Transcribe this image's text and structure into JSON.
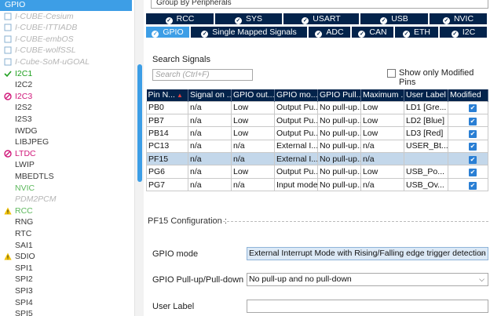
{
  "tree": [
    {
      "label": "GPIO",
      "style": "selected",
      "icon": ""
    },
    {
      "label": "I-CUBE-Cesium",
      "style": "grey",
      "icon": "component-icon"
    },
    {
      "label": "I-CUBE-ITTIADB",
      "style": "grey",
      "icon": "component-icon"
    },
    {
      "label": "I-CUBE-embOS",
      "style": "grey",
      "icon": "component-icon"
    },
    {
      "label": "I-CUBE-wolfSSL",
      "style": "grey",
      "icon": "component-icon"
    },
    {
      "label": "I-Cube-SoM-uGOAL",
      "style": "grey",
      "icon": "component-icon"
    },
    {
      "label": "I2C1",
      "style": "green",
      "icon": "check-icon"
    },
    {
      "label": "I2C2",
      "style": "dark",
      "icon": ""
    },
    {
      "label": "I2C3",
      "style": "magenta",
      "icon": "blocked-icon"
    },
    {
      "label": "I2S2",
      "style": "dark",
      "icon": ""
    },
    {
      "label": "I2S3",
      "style": "dark",
      "icon": ""
    },
    {
      "label": "IWDG",
      "style": "dark",
      "icon": ""
    },
    {
      "label": "LIBJPEG",
      "style": "dark",
      "icon": ""
    },
    {
      "label": "LTDC",
      "style": "magenta",
      "icon": "blocked-icon"
    },
    {
      "label": "LWIP",
      "style": "dark",
      "icon": ""
    },
    {
      "label": "MBEDTLS",
      "style": "dark",
      "icon": ""
    },
    {
      "label": "NVIC",
      "style": "lightgreen",
      "icon": ""
    },
    {
      "label": "PDM2PCM",
      "style": "grey",
      "icon": ""
    },
    {
      "label": "RCC",
      "style": "lightgreen",
      "icon": "warning-icon"
    },
    {
      "label": "RNG",
      "style": "dark",
      "icon": ""
    },
    {
      "label": "RTC",
      "style": "dark",
      "icon": ""
    },
    {
      "label": "SAI1",
      "style": "dark",
      "icon": ""
    },
    {
      "label": "SDIO",
      "style": "dark",
      "icon": "warning-icon"
    },
    {
      "label": "SPI1",
      "style": "dark",
      "icon": ""
    },
    {
      "label": "SPI2",
      "style": "dark",
      "icon": ""
    },
    {
      "label": "SPI3",
      "style": "dark",
      "icon": ""
    },
    {
      "label": "SPI4",
      "style": "dark",
      "icon": ""
    },
    {
      "label": "SPI5",
      "style": "dark",
      "icon": ""
    }
  ],
  "group_select": "Group By Peripherals",
  "tabs_row1": [
    "RCC",
    "SYS",
    "USART",
    "USB",
    "NVIC"
  ],
  "tabs_row2": [
    "GPIO",
    "Single Mapped Signals",
    "ADC",
    "CAN",
    "ETH",
    "I2C"
  ],
  "active_tab": "GPIO",
  "search": {
    "title": "Search Signals",
    "placeholder": "Search (Ctrl+F)"
  },
  "show_modified_label": "Show only Modified Pins",
  "columns": [
    "Pin N...",
    "Signal on ...",
    "GPIO out...",
    "GPIO mo...",
    "GPIO Pull...",
    "Maximum ...",
    "User Label",
    "Modified"
  ],
  "rows": [
    [
      "PB0",
      "n/a",
      "Low",
      "Output Pu...",
      "No pull-up...",
      "Low",
      "LD1 [Gre...",
      "true"
    ],
    [
      "PB7",
      "n/a",
      "Low",
      "Output Pu...",
      "No pull-up...",
      "Low",
      "LD2 [Blue]",
      "true"
    ],
    [
      "PB14",
      "n/a",
      "Low",
      "Output Pu...",
      "No pull-up...",
      "Low",
      "LD3 [Red]",
      "true"
    ],
    [
      "PC13",
      "n/a",
      "n/a",
      "External I...",
      "No pull-up...",
      "n/a",
      "USER_Bt...",
      "true"
    ],
    [
      "PF15",
      "n/a",
      "n/a",
      "External I...",
      "No pull-up...",
      "n/a",
      "",
      "true"
    ],
    [
      "PG6",
      "n/a",
      "Low",
      "Output Pu...",
      "No pull-up...",
      "Low",
      "USB_Po...",
      "true"
    ],
    [
      "PG7",
      "n/a",
      "n/a",
      "Input mode",
      "No pull-up...",
      "n/a",
      "USB_Ov...",
      "true"
    ]
  ],
  "selected_row": 4,
  "config": {
    "title": "PF15 Configuration :",
    "gpio_mode_label": "GPIO mode",
    "gpio_mode_value": "External Interrupt Mode with Rising/Falling edge trigger detection",
    "pull_label": "GPIO Pull-up/Pull-down",
    "pull_value": "No pull-up and no pull-down",
    "user_label_label": "User Label",
    "user_label_value": ""
  }
}
